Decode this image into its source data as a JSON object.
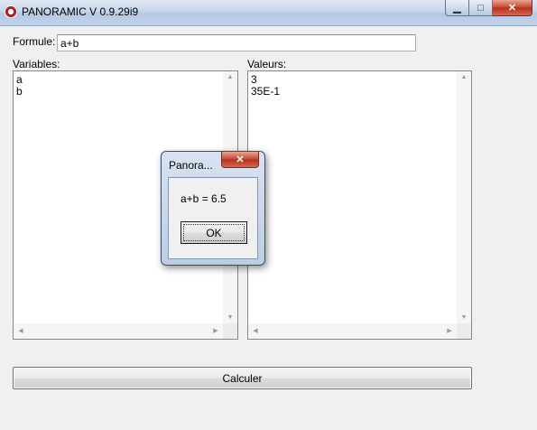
{
  "window": {
    "title": "PANORAMIC V 0.9.29i9"
  },
  "caption": {
    "minimize": "▁",
    "maximize": "□",
    "close": "✕"
  },
  "form": {
    "formula_label": "Formule:",
    "formula_value": "a+b",
    "variables_label": "Variables:",
    "values_label": "Valeurs:",
    "variables": [
      "a",
      "b"
    ],
    "values": [
      "3",
      "35E-1"
    ],
    "calculate_button": "Calculer"
  },
  "dialog": {
    "title": "Panora...",
    "close": "✕",
    "message": "a+b = 6.5",
    "ok_button": "OK"
  }
}
